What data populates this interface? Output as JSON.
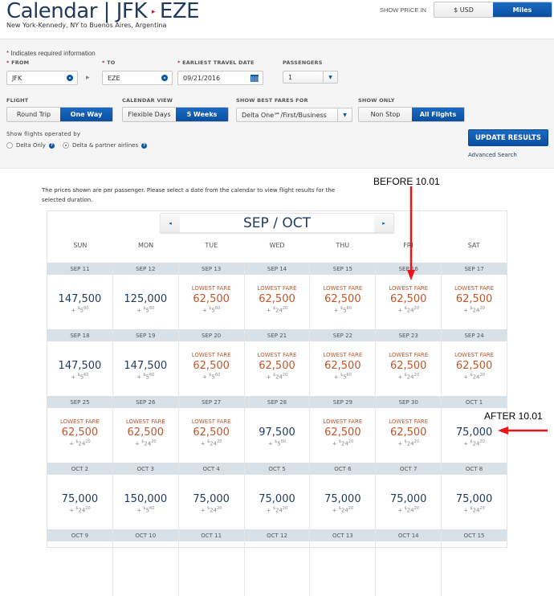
{
  "header": {
    "title_prefix": "Calendar | JFK",
    "title_arrow": "▸",
    "title_dest": "EZE",
    "subtitle": "New York-Kennedy, NY to Buenos Aires, Argentina",
    "show_price_in_label": "SHOW PRICE IN",
    "price_options": [
      "$ USD",
      "Miles"
    ],
    "price_selected": "Miles"
  },
  "form": {
    "required_note": "Indicates required information",
    "from_label": "FROM",
    "from_value": "JFK",
    "to_label": "TO",
    "to_value": "EZE",
    "date_label": "EARLIEST TRAVEL DATE",
    "date_value": "09/21/2016",
    "passengers_label": "PASSENGERS",
    "passengers_value": "1",
    "flight_label": "FLIGHT",
    "flight_options": [
      "Round Trip",
      "One Way"
    ],
    "flight_selected": "One Way",
    "calview_label": "CALENDAR VIEW",
    "calview_options": [
      "Flexible Days",
      "5 Weeks"
    ],
    "calview_selected": "5 Weeks",
    "bestfares_label": "SHOW BEST FARES FOR",
    "bestfares_value": "Delta One℠/First/Business",
    "showonly_label": "SHOW ONLY",
    "showonly_options": [
      "Non Stop",
      "All Flights"
    ],
    "showonly_selected": "All Flights",
    "operated_label": "Show flights operated by",
    "operated_options": [
      "Delta Only",
      "Delta & partner airlines"
    ],
    "operated_selected": "Delta & partner airlines",
    "update_button": "UPDATE RESULTS",
    "advanced_link": "Advanced Search"
  },
  "calendar": {
    "note": "The prices shown are per passenger. Please select a date from the calendar to view flight results for the selected duration.",
    "month": "SEP / OCT",
    "prev_icon": "◂",
    "next_icon": "▸",
    "days_of_week": [
      "SUN",
      "MON",
      "TUE",
      "WED",
      "THU",
      "FRI",
      "SAT"
    ],
    "lowest_label": "LOWEST FARE",
    "weeks": [
      [
        {
          "date": "SEP 11",
          "miles": "147,500",
          "tax_d": "5",
          "tax_c": "60",
          "lowest": false
        },
        {
          "date": "SEP 12",
          "miles": "125,000",
          "tax_d": "5",
          "tax_c": "60",
          "lowest": false
        },
        {
          "date": "SEP 13",
          "miles": "62,500",
          "tax_d": "5",
          "tax_c": "60",
          "lowest": true
        },
        {
          "date": "SEP 14",
          "miles": "62,500",
          "tax_d": "24",
          "tax_c": "20",
          "lowest": true
        },
        {
          "date": "SEP 15",
          "miles": "62,500",
          "tax_d": "5",
          "tax_c": "60",
          "lowest": true
        },
        {
          "date": "SEP 16",
          "miles": "62,500",
          "tax_d": "24",
          "tax_c": "20",
          "lowest": true
        },
        {
          "date": "SEP 17",
          "miles": "62,500",
          "tax_d": "24",
          "tax_c": "20",
          "lowest": true
        }
      ],
      [
        {
          "date": "SEP 18",
          "miles": "147,500",
          "tax_d": "5",
          "tax_c": "60",
          "lowest": false
        },
        {
          "date": "SEP 19",
          "miles": "147,500",
          "tax_d": "5",
          "tax_c": "60",
          "lowest": false
        },
        {
          "date": "SEP 20",
          "miles": "62,500",
          "tax_d": "5",
          "tax_c": "60",
          "lowest": true
        },
        {
          "date": "SEP 21",
          "miles": "62,500",
          "tax_d": "24",
          "tax_c": "20",
          "lowest": true
        },
        {
          "date": "SEP 22",
          "miles": "62,500",
          "tax_d": "5",
          "tax_c": "60",
          "lowest": true
        },
        {
          "date": "SEP 23",
          "miles": "62,500",
          "tax_d": "24",
          "tax_c": "20",
          "lowest": true
        },
        {
          "date": "SEP 24",
          "miles": "62,500",
          "tax_d": "24",
          "tax_c": "20",
          "lowest": true
        }
      ],
      [
        {
          "date": "SEP 25",
          "miles": "62,500",
          "tax_d": "24",
          "tax_c": "20",
          "lowest": true
        },
        {
          "date": "SEP 26",
          "miles": "62,500",
          "tax_d": "24",
          "tax_c": "20",
          "lowest": true
        },
        {
          "date": "SEP 27",
          "miles": "62,500",
          "tax_d": "24",
          "tax_c": "20",
          "lowest": true
        },
        {
          "date": "SEP 28",
          "miles": "97,500",
          "tax_d": "5",
          "tax_c": "60",
          "lowest": false
        },
        {
          "date": "SEP 29",
          "miles": "62,500",
          "tax_d": "24",
          "tax_c": "20",
          "lowest": true
        },
        {
          "date": "SEP 30",
          "miles": "62,500",
          "tax_d": "24",
          "tax_c": "20",
          "lowest": true
        },
        {
          "date": "OCT 1",
          "miles": "75,000",
          "tax_d": "24",
          "tax_c": "20",
          "lowest": false
        }
      ],
      [
        {
          "date": "OCT 2",
          "miles": "75,000",
          "tax_d": "24",
          "tax_c": "20",
          "lowest": false
        },
        {
          "date": "OCT 3",
          "miles": "150,000",
          "tax_d": "5",
          "tax_c": "60",
          "lowest": false
        },
        {
          "date": "OCT 4",
          "miles": "75,000",
          "tax_d": "24",
          "tax_c": "20",
          "lowest": false
        },
        {
          "date": "OCT 5",
          "miles": "75,000",
          "tax_d": "24",
          "tax_c": "20",
          "lowest": false
        },
        {
          "date": "OCT 6",
          "miles": "75,000",
          "tax_d": "24",
          "tax_c": "20",
          "lowest": false
        },
        {
          "date": "OCT 7",
          "miles": "75,000",
          "tax_d": "24",
          "tax_c": "20",
          "lowest": false
        },
        {
          "date": "OCT 8",
          "miles": "75,000",
          "tax_d": "24",
          "tax_c": "20",
          "lowest": false
        }
      ],
      [
        {
          "date": "OCT 9"
        },
        {
          "date": "OCT 10"
        },
        {
          "date": "OCT 11"
        },
        {
          "date": "OCT 12"
        },
        {
          "date": "OCT 13"
        },
        {
          "date": "OCT 14"
        },
        {
          "date": "OCT 15"
        }
      ]
    ]
  },
  "annotations": {
    "before": "BEFORE 10.01",
    "after": "AFTER 10.01",
    "arrow_color": "#e8161b"
  }
}
